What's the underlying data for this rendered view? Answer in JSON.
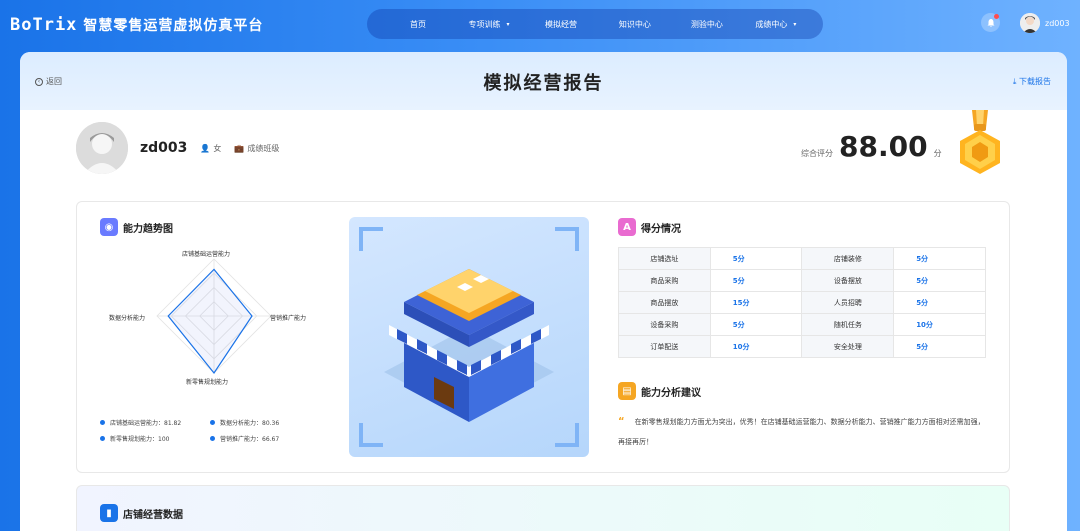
{
  "app": {
    "brand": "BoTrix",
    "system_name": "智慧零售运营虚拟仿真平台"
  },
  "nav": {
    "items": [
      {
        "label": "首页",
        "dropdown": false
      },
      {
        "label": "专项训练",
        "dropdown": true
      },
      {
        "label": "模拟经营",
        "dropdown": false
      },
      {
        "label": "知识中心",
        "dropdown": false
      },
      {
        "label": "测验中心",
        "dropdown": false
      },
      {
        "label": "成绩中心",
        "dropdown": true
      }
    ]
  },
  "user": {
    "name": "zd003"
  },
  "page": {
    "title": "模拟经营报告",
    "back_label": "返回",
    "download_label": "下载报告"
  },
  "profile": {
    "name": "zd003",
    "gender": "女",
    "class_name": "成绩班级"
  },
  "score": {
    "label": "综合评分",
    "value": "88.00",
    "unit": "分"
  },
  "ability": {
    "title": "能力趋势图",
    "axes": [
      "店铺基础运营能力",
      "营销推广能力",
      "新零售规划能力",
      "数据分析能力"
    ],
    "values": [
      81.82,
      66.67,
      100,
      80.36
    ],
    "legend": [
      "店铺基础运营能力：81.82",
      "数据分析能力：80.36",
      "新零售规划能力：100",
      "营销推广能力：66.67"
    ]
  },
  "scores": {
    "title": "得分情况",
    "rows": [
      [
        {
          "k": "店铺选址",
          "v": "5分"
        },
        {
          "k": "店铺装修",
          "v": "5分"
        }
      ],
      [
        {
          "k": "商品采购",
          "v": "5分"
        },
        {
          "k": "设备摆放",
          "v": "5分"
        }
      ],
      [
        {
          "k": "商品摆放",
          "v": "15分"
        },
        {
          "k": "人员招聘",
          "v": "5分"
        }
      ],
      [
        {
          "k": "设备采购",
          "v": "5分"
        },
        {
          "k": "随机任务",
          "v": "10分"
        }
      ],
      [
        {
          "k": "订单配送",
          "v": "10分"
        },
        {
          "k": "安全处理",
          "v": "5分"
        }
      ]
    ]
  },
  "advice": {
    "title": "能力分析建议",
    "text": "在新零售规划能力方面尤为突出，优秀！在店铺基础运营能力、数据分析能力、营销推广能力方面相对还需加强，再接再厉！"
  },
  "store_data": {
    "title": "店铺经营数据"
  },
  "colors": {
    "primary": "#1a73e8",
    "accent": "#f5a623"
  }
}
